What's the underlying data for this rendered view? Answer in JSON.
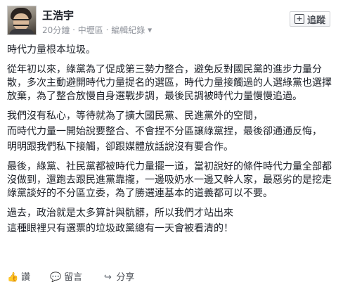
{
  "post": {
    "author": "王浩宇",
    "time": "20分鐘",
    "location": "中壢區",
    "edit_history": "編輯紀錄",
    "follow_label": "追蹤",
    "paragraphs": [
      "時代力量根本垃圾。",
      "從年初以來，綠黨為了促成第三勢力整合，避免反對國民黨的進步力量分散，多次主動避開時代力量提名的選區，時代力量接觸過的人選綠黨也選擇放棄，為了整合放慢自身選戰步調，最後民調被時代力量慢慢追過。",
      "我們沒有私心，等待就為了擴大國民黨、民進黨外的空間，",
      "而時代力量一開始說要整合、不會捏不分區譲綠黨捏，最後卻通通反悔，",
      "明明跟我們私下接觸，卻跟媒體放話說沒有要合作。",
      "最後，綠黨、社民黨都被時代力量擺一道，當初說好的條件時代力量全部都沒做到，還跑去跟民進黨靠攏，一邊吸奶水一邊又幹人家，最惡劣的是挖走綠黨談好的不分區立委，為了勝選連基本的道義都可以不要。",
      "過去，政治就是太多算計與骯髒，所以我們才站出來",
      "這種眼裡只有選票的垃圾政黨總有一天會被看清的！"
    ],
    "actions": {
      "like": "讚",
      "comment": "留言",
      "share": "分享"
    }
  }
}
